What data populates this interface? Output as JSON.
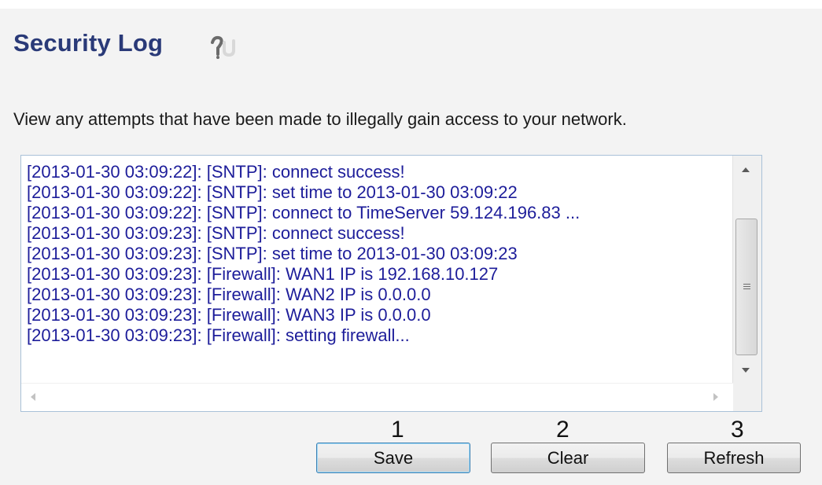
{
  "page": {
    "title": "Security Log",
    "description": "View any attempts that have been made to illegally gain access to your network."
  },
  "log": {
    "lines": [
      "[2013-01-30 03:09:22]: [SNTP]: connect success!",
      "[2013-01-30 03:09:22]: [SNTP]: set time to 2013-01-30 03:09:22",
      "[2013-01-30 03:09:22]: [SNTP]: connect to TimeServer 59.124.196.83 ...",
      "[2013-01-30 03:09:23]: [SNTP]: connect success!",
      "[2013-01-30 03:09:23]: [SNTP]: set time to 2013-01-30 03:09:23",
      "[2013-01-30 03:09:23]: [Firewall]: WAN1 IP is 192.168.10.127",
      "[2013-01-30 03:09:23]: [Firewall]: WAN2 IP is 0.0.0.0",
      "[2013-01-30 03:09:23]: [Firewall]: WAN3 IP is 0.0.0.0",
      "[2013-01-30 03:09:23]: [Firewall]: setting firewall..."
    ]
  },
  "annotations": {
    "marker_1": "1",
    "marker_2": "2",
    "marker_3": "3"
  },
  "buttons": {
    "save_label": "Save",
    "clear_label": "Clear",
    "refresh_label": "Refresh"
  },
  "icons": {
    "help": "help-icon",
    "scroll_up": "chevron-up-icon",
    "scroll_down": "chevron-down-icon",
    "scroll_left": "chevron-left-icon",
    "scroll_right": "chevron-right-icon"
  },
  "colors": {
    "title": "#2a3a78",
    "log_text": "#1d1d9a",
    "save_border": "#3c7fb1"
  }
}
